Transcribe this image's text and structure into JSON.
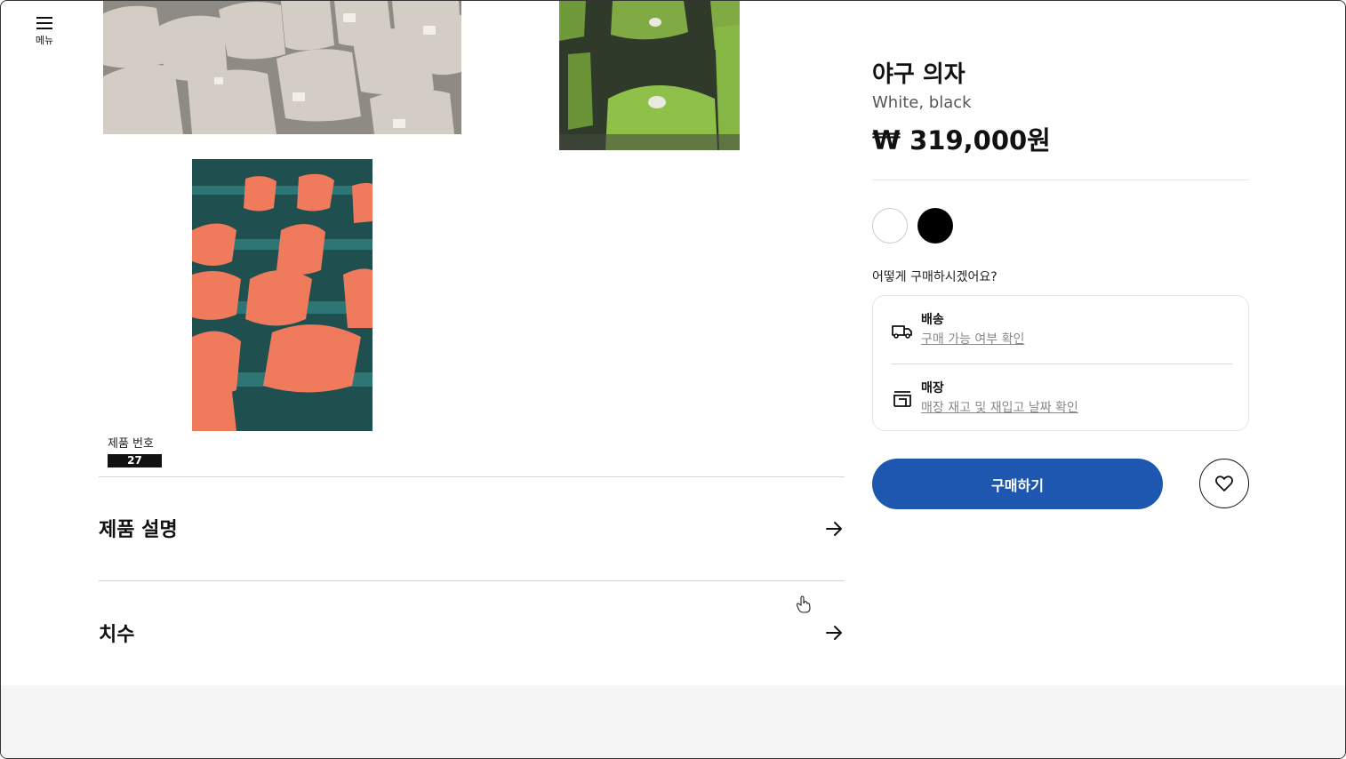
{
  "menu": {
    "label": "메뉴",
    "icon": "menu-icon"
  },
  "gallery": {
    "images": [
      {
        "name": "beige-stadium-seats",
        "color": "#cfc9c1"
      },
      {
        "name": "green-stadium-seats",
        "color": "#8fc04a"
      },
      {
        "name": "orange-stadium-seats",
        "color": "#f07a5c"
      }
    ]
  },
  "article": {
    "label": "제품 번호",
    "number": "27"
  },
  "sections": [
    {
      "title": "제품 설명"
    },
    {
      "title": "치수"
    }
  ],
  "product": {
    "name": "야구 의자",
    "description": "White, black",
    "price": "₩ 319,000원"
  },
  "colors": [
    {
      "name": "white",
      "hex": "#ffffff"
    },
    {
      "name": "black",
      "hex": "#000000"
    }
  ],
  "purchase": {
    "question": "어떻게 구매하시겠어요?",
    "options": [
      {
        "title": "배송",
        "link": "구매 가능 여부 확인",
        "icon": "truck-icon"
      },
      {
        "title": "매장",
        "link": "매장 재고 및 재입고 날짜 확인",
        "icon": "store-icon"
      }
    ]
  },
  "actions": {
    "buy_label": "구매하기",
    "favorite_icon": "heart-icon",
    "accent": "#1d57b0"
  }
}
